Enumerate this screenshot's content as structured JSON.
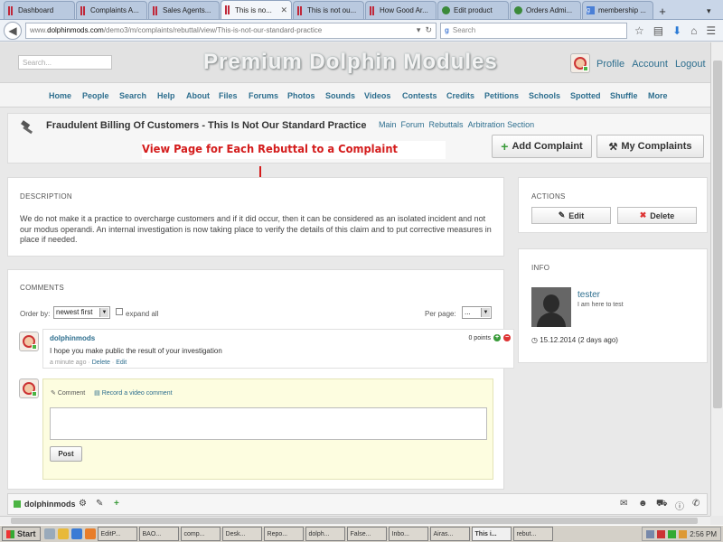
{
  "browser": {
    "tabs": [
      {
        "label": "Dashboard",
        "icon": "dolphin-icon"
      },
      {
        "label": "Complaints A...",
        "icon": "dolphin-icon"
      },
      {
        "label": "Sales Agents...",
        "icon": "dolphin-icon"
      },
      {
        "label": "This is no...",
        "icon": "dolphin-icon",
        "active": true
      },
      {
        "label": "This is not ou...",
        "icon": "dolphin-icon"
      },
      {
        "label": "How Good Ar...",
        "icon": "dolphin-icon"
      },
      {
        "label": "Edit product",
        "icon": "oc-icon"
      },
      {
        "label": "Orders Admi...",
        "icon": "oc-icon"
      },
      {
        "label": "membership ...",
        "icon": "google-icon"
      }
    ],
    "url_domain": "dolphinmods.com",
    "url_prefix": "www.",
    "url_path": "/demo3/m/complaints/rebuttal/view/This-is-not-our-standard-practice",
    "search_placeholder": "Search"
  },
  "site": {
    "search_placeholder": "Search...",
    "title": "Premium Dolphin Modules",
    "header_links": [
      "Profile",
      "Account",
      "Logout"
    ],
    "menu": [
      "Home",
      "People",
      "Search",
      "Help",
      "About",
      "Files",
      "Forums",
      "Photos",
      "Sounds",
      "Videos",
      "Contests",
      "Credits",
      "Petitions",
      "Schools",
      "Spotted",
      "Shuffle",
      "More"
    ]
  },
  "page": {
    "title": "Fraudulent Billing Of Customers - This Is Not Our Standard Practice",
    "breadcrumbs": [
      "Main",
      "Forum",
      "Rebuttals",
      "Arbitration Section"
    ],
    "add_complaint": "Add Complaint",
    "my_complaints": "My Complaints",
    "annotation": "View Page for Each Rebuttal to a Complaint",
    "annotation_color": "#d41c1c"
  },
  "description": {
    "heading": "DESCRIPTION",
    "text": "We do not make it a practice to overcharge customers and if it did occur, then it can be considered as an isolated incident and not our modus operandi. An internal investigation is now taking place to verify the details of this claim and to put corrective measures in place if needed."
  },
  "comments": {
    "heading": "COMMENTS",
    "order_label": "Order by:",
    "order_value": "newest first",
    "expand_label": "expand all",
    "per_page_label": "Per page:",
    "per_page_value": "...",
    "items": [
      {
        "author": "dolphinmods",
        "text": "I hope you make public the result of your investigation",
        "time": "a minute ago",
        "actions": [
          "Delete",
          "Edit"
        ],
        "points": "0 points"
      }
    ],
    "reply_tab_comment": "Comment",
    "reply_tab_video": "Record a video comment",
    "post_label": "Post"
  },
  "actions": {
    "heading": "ACTIONS",
    "edit": "Edit",
    "delete": "Delete"
  },
  "info": {
    "heading": "INFO",
    "name": "tester",
    "status": "I am here to test",
    "date": "15.12.2014 (2 days ago)"
  },
  "member_bar": {
    "name": "dolphinmods"
  },
  "taskbar": {
    "start": "Start",
    "tasks": [
      "EditP...",
      "BAO...",
      "comp...",
      "Desk...",
      "Repo...",
      "dolph...",
      "False...",
      "Inbo...",
      "Airas...",
      "This i...",
      "rebut..."
    ],
    "active_index": 9,
    "clock": "2:56 PM"
  }
}
